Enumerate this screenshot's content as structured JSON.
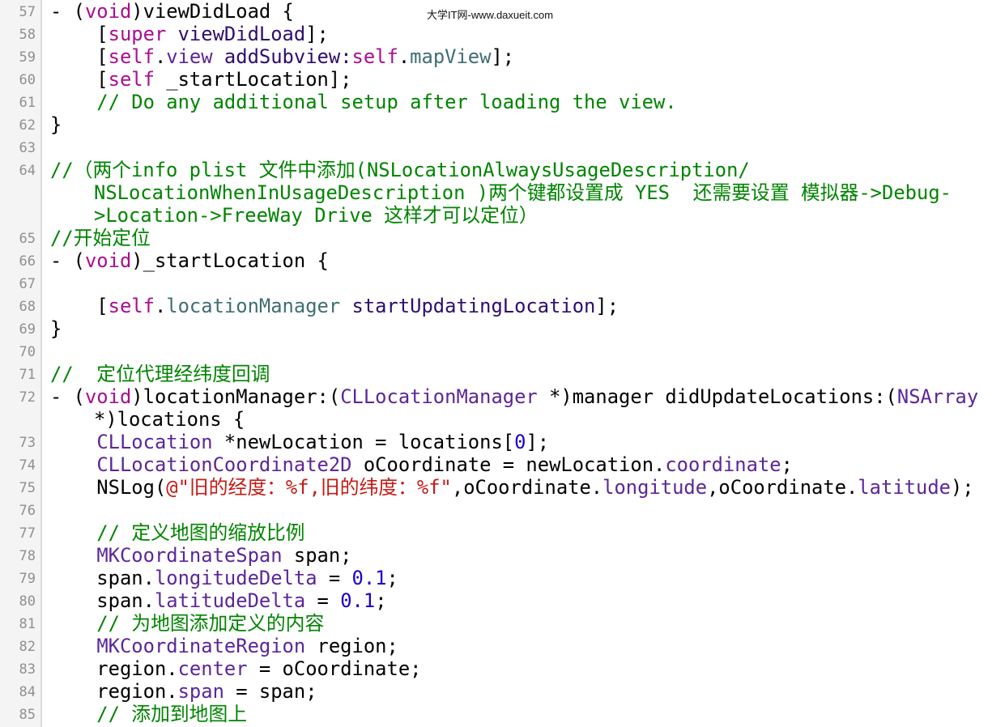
{
  "watermark": "大学IT网-www.daxueit.com",
  "lines": [
    {
      "num": "57",
      "tokens": [
        [
          "- (",
          ""
        ],
        [
          "void",
          "kw"
        ],
        [
          ")viewDidLoad {",
          ""
        ]
      ]
    },
    {
      "num": "58",
      "tokens": [
        [
          "    [",
          ""
        ],
        [
          "super",
          "kw"
        ],
        [
          " ",
          ""
        ],
        [
          "viewDidLoad",
          "me"
        ],
        [
          "];",
          ""
        ]
      ]
    },
    {
      "num": "59",
      "tokens": [
        [
          "    [",
          ""
        ],
        [
          "self",
          "kw"
        ],
        [
          ".",
          ""
        ],
        [
          "view",
          "ty"
        ],
        [
          " ",
          ""
        ],
        [
          "addSubview:",
          "me"
        ],
        [
          "self",
          "kw"
        ],
        [
          ".",
          ""
        ],
        [
          "mapView",
          "pr"
        ],
        [
          "];",
          ""
        ]
      ]
    },
    {
      "num": "60",
      "tokens": [
        [
          "    [",
          ""
        ],
        [
          "self",
          "kw"
        ],
        [
          " _startLocation];",
          ""
        ]
      ]
    },
    {
      "num": "61",
      "tokens": [
        [
          "    // Do any additional setup after loading the view.",
          "cm"
        ]
      ]
    },
    {
      "num": "62",
      "tokens": [
        [
          "}",
          ""
        ]
      ]
    },
    {
      "num": "63",
      "tokens": []
    },
    {
      "num": "64",
      "tokens": [
        [
          "//（两个info plist 文件中添加(NSLocationAlwaysUsageDescription/",
          "cm"
        ]
      ]
    },
    {
      "num": "",
      "cont": true,
      "tokens": [
        [
          "NSLocationWhenInUsageDescription )两个键都设置成 YES  还需要设置 模拟器->Debug-",
          "cm"
        ]
      ]
    },
    {
      "num": "",
      "cont": true,
      "tokens": [
        [
          ">Location->FreeWay Drive 这样才可以定位）",
          "cm"
        ]
      ]
    },
    {
      "num": "65",
      "tokens": [
        [
          "//开始定位",
          "cm"
        ]
      ]
    },
    {
      "num": "66",
      "tokens": [
        [
          "- (",
          ""
        ],
        [
          "void",
          "kw"
        ],
        [
          ")_startLocation {",
          ""
        ]
      ]
    },
    {
      "num": "67",
      "tokens": []
    },
    {
      "num": "68",
      "tokens": [
        [
          "    [",
          ""
        ],
        [
          "self",
          "kw"
        ],
        [
          ".",
          ""
        ],
        [
          "locationManager",
          "pr"
        ],
        [
          " ",
          ""
        ],
        [
          "startUpdatingLocation",
          "me"
        ],
        [
          "];",
          ""
        ]
      ]
    },
    {
      "num": "69",
      "tokens": [
        [
          "}",
          ""
        ]
      ]
    },
    {
      "num": "70",
      "tokens": []
    },
    {
      "num": "71",
      "tokens": [
        [
          "//  定位代理经纬度回调",
          "cm"
        ]
      ]
    },
    {
      "num": "72",
      "tokens": [
        [
          "- (",
          ""
        ],
        [
          "void",
          "kw"
        ],
        [
          ")locationManager:(",
          ""
        ],
        [
          "CLLocationManager",
          "ty"
        ],
        [
          " *)manager didUpdateLocations:(",
          ""
        ],
        [
          "NSArray",
          "ty"
        ]
      ]
    },
    {
      "num": "",
      "cont": true,
      "tokens": [
        [
          "*)locations {",
          ""
        ]
      ]
    },
    {
      "num": "73",
      "tokens": [
        [
          "    ",
          ""
        ],
        [
          "CLLocation",
          "ty"
        ],
        [
          " *newLocation = locations[",
          ""
        ],
        [
          "0",
          "nu"
        ],
        [
          "];",
          ""
        ]
      ]
    },
    {
      "num": "74",
      "tokens": [
        [
          "    ",
          ""
        ],
        [
          "CLLocationCoordinate2D",
          "ty"
        ],
        [
          " oCoordinate = newLocation.",
          ""
        ],
        [
          "coordinate",
          "ty"
        ],
        [
          ";",
          ""
        ]
      ]
    },
    {
      "num": "75",
      "tokens": [
        [
          "    NSLog(",
          ""
        ],
        [
          "@\"旧的经度：%f,旧的纬度：%f\"",
          "st"
        ],
        [
          ",oCoordinate.",
          ""
        ],
        [
          "longitude",
          "ty"
        ],
        [
          ",oCoordinate.",
          ""
        ],
        [
          "latitude",
          "ty"
        ],
        [
          ");",
          ""
        ]
      ]
    },
    {
      "num": "76",
      "tokens": []
    },
    {
      "num": "77",
      "tokens": [
        [
          "    // 定义地图的缩放比例",
          "cm"
        ]
      ]
    },
    {
      "num": "78",
      "tokens": [
        [
          "    ",
          ""
        ],
        [
          "MKCoordinateSpan",
          "ty"
        ],
        [
          " span;",
          ""
        ]
      ]
    },
    {
      "num": "79",
      "tokens": [
        [
          "    span.",
          ""
        ],
        [
          "longitudeDelta",
          "ty"
        ],
        [
          " = ",
          ""
        ],
        [
          "0.1",
          "nu"
        ],
        [
          ";",
          ""
        ]
      ]
    },
    {
      "num": "80",
      "tokens": [
        [
          "    span.",
          ""
        ],
        [
          "latitudeDelta",
          "ty"
        ],
        [
          " = ",
          ""
        ],
        [
          "0.1",
          "nu"
        ],
        [
          ";",
          ""
        ]
      ]
    },
    {
      "num": "81",
      "tokens": [
        [
          "    // 为地图添加定义的内容",
          "cm"
        ]
      ]
    },
    {
      "num": "82",
      "tokens": [
        [
          "    ",
          ""
        ],
        [
          "MKCoordinateRegion",
          "ty"
        ],
        [
          " region;",
          ""
        ]
      ]
    },
    {
      "num": "83",
      "tokens": [
        [
          "    region.",
          ""
        ],
        [
          "center",
          "ty"
        ],
        [
          " = oCoordinate;",
          ""
        ]
      ]
    },
    {
      "num": "84",
      "tokens": [
        [
          "    region.",
          ""
        ],
        [
          "span",
          "ty"
        ],
        [
          " = span;",
          ""
        ]
      ]
    },
    {
      "num": "85",
      "tokens": [
        [
          "    // 添加到地图上",
          "cm"
        ]
      ]
    }
  ]
}
